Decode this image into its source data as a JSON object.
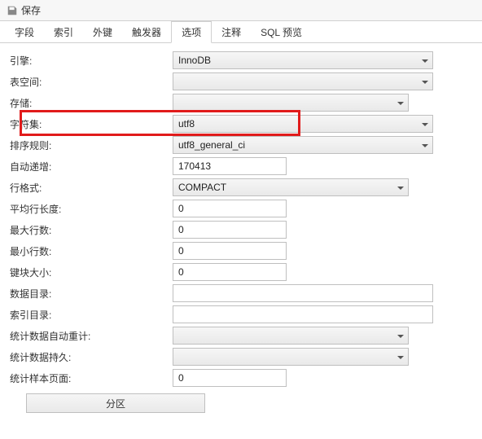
{
  "toolbar": {
    "save_label": "保存"
  },
  "tabs": {
    "items": [
      {
        "label": "字段"
      },
      {
        "label": "索引"
      },
      {
        "label": "外键"
      },
      {
        "label": "触发器"
      },
      {
        "label": "选项"
      },
      {
        "label": "注释"
      },
      {
        "label": "SQL 预览"
      }
    ],
    "active_index": 4
  },
  "form": {
    "engine": {
      "label": "引擎:",
      "value": "InnoDB",
      "type": "select",
      "width": "wide"
    },
    "tablespace": {
      "label": "表空间:",
      "value": "",
      "type": "select",
      "width": "wide"
    },
    "storage": {
      "label": "存储:",
      "value": "",
      "type": "select",
      "width": "narrow"
    },
    "charset": {
      "label": "字符集:",
      "value": "utf8",
      "type": "select",
      "width": "wide",
      "highlight": true
    },
    "collation": {
      "label": "排序规则:",
      "value": "utf8_general_ci",
      "type": "select",
      "width": "wide"
    },
    "autoinc": {
      "label": "自动递增:",
      "value": "170413",
      "type": "input",
      "width": "short"
    },
    "row_format": {
      "label": "行格式:",
      "value": "COMPACT",
      "type": "select",
      "width": "narrow"
    },
    "avg_row_len": {
      "label": "平均行长度:",
      "value": "0",
      "type": "input",
      "width": "short"
    },
    "max_rows": {
      "label": "最大行数:",
      "value": "0",
      "type": "input",
      "width": "short"
    },
    "min_rows": {
      "label": "最小行数:",
      "value": "0",
      "type": "input",
      "width": "short"
    },
    "key_block": {
      "label": "键块大小:",
      "value": "0",
      "type": "input",
      "width": "short"
    },
    "data_dir": {
      "label": "数据目录:",
      "value": "",
      "type": "input",
      "width": "long"
    },
    "index_dir": {
      "label": "索引目录:",
      "value": "",
      "type": "input",
      "width": "long"
    },
    "stats_auto": {
      "label": "统计数据自动重计:",
      "value": "",
      "type": "select",
      "width": "narrow"
    },
    "stats_persist": {
      "label": "统计数据持久:",
      "value": "",
      "type": "select",
      "width": "narrow"
    },
    "stats_sample": {
      "label": "统计样本页面:",
      "value": "0",
      "type": "input",
      "width": "short"
    }
  },
  "form_order": [
    "engine",
    "tablespace",
    "storage",
    "charset",
    "collation",
    "autoinc",
    "row_format",
    "avg_row_len",
    "max_rows",
    "min_rows",
    "key_block",
    "data_dir",
    "index_dir",
    "stats_auto",
    "stats_persist",
    "stats_sample"
  ],
  "partition_button": "分区"
}
